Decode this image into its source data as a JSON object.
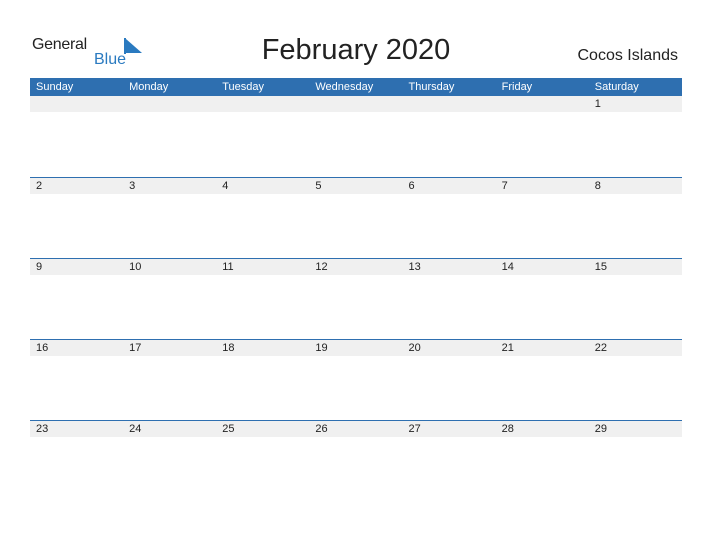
{
  "logo": {
    "general": "General",
    "blue": "Blue"
  },
  "header": {
    "title": "February 2020",
    "country": "Cocos Islands"
  },
  "calendar": {
    "days": [
      "Sunday",
      "Monday",
      "Tuesday",
      "Wednesday",
      "Thursday",
      "Friday",
      "Saturday"
    ],
    "weeks": [
      [
        "",
        "",
        "",
        "",
        "",
        "",
        "1"
      ],
      [
        "2",
        "3",
        "4",
        "5",
        "6",
        "7",
        "8"
      ],
      [
        "9",
        "10",
        "11",
        "12",
        "13",
        "14",
        "15"
      ],
      [
        "16",
        "17",
        "18",
        "19",
        "20",
        "21",
        "22"
      ],
      [
        "23",
        "24",
        "25",
        "26",
        "27",
        "28",
        "29"
      ]
    ]
  },
  "colors": {
    "accent": "#2e6fb0",
    "logo_blue": "#2a7ac0",
    "strip": "#f0f0f0"
  }
}
